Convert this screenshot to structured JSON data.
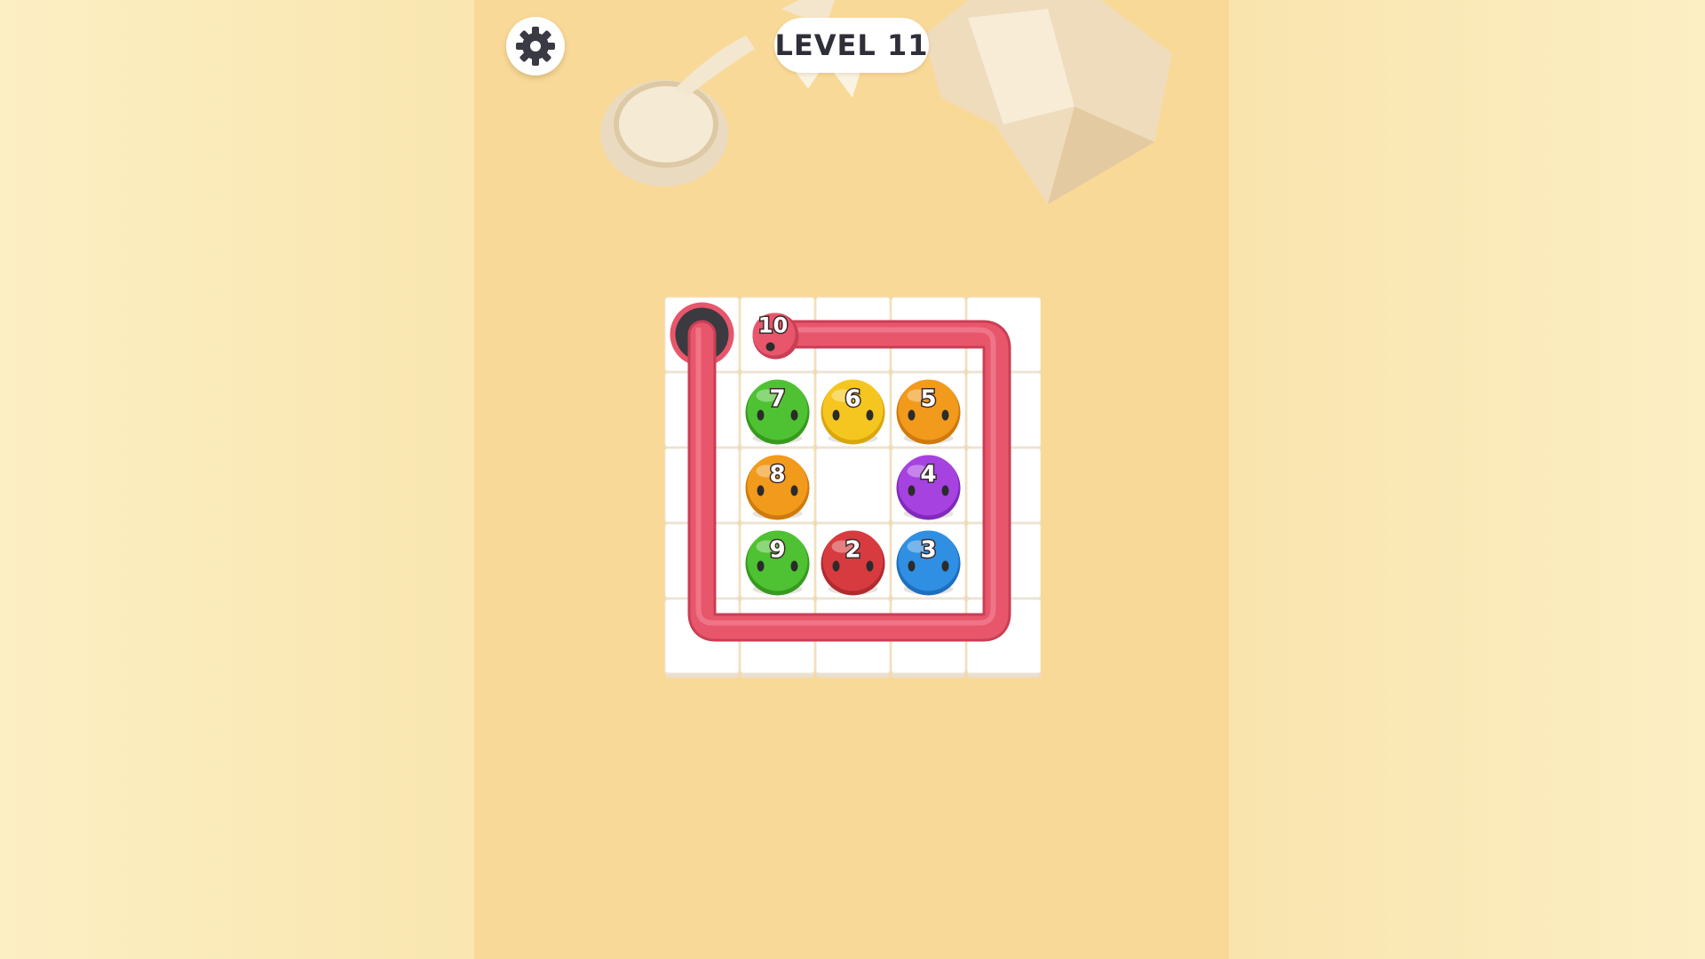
{
  "header": {
    "level_label": "LEVEL 11"
  },
  "icons": {
    "settings": "gear-icon"
  },
  "colors": {
    "background": "#f8d998",
    "board_tile": "#ffffff",
    "snake": "#e8566b",
    "hole": "#3a3a40",
    "green": "#4fc233",
    "yellow": "#f5c61f",
    "orange": "#f29a1c",
    "purple": "#a643e0",
    "red": "#d83b3f",
    "blue": "#2f8fe3"
  },
  "board": {
    "rows": 5,
    "cols": 5,
    "hole": {
      "row": 0,
      "col": 0
    },
    "snake": {
      "number": "10",
      "color": "red",
      "head": {
        "row": 0,
        "col": 1
      }
    },
    "balls": [
      {
        "number": "7",
        "color": "green",
        "row": 1,
        "col": 1
      },
      {
        "number": "6",
        "color": "yellow",
        "row": 1,
        "col": 2
      },
      {
        "number": "5",
        "color": "orange",
        "row": 1,
        "col": 3
      },
      {
        "number": "8",
        "color": "orange",
        "row": 2,
        "col": 1
      },
      {
        "number": "4",
        "color": "purple",
        "row": 2,
        "col": 3
      },
      {
        "number": "9",
        "color": "green",
        "row": 3,
        "col": 1
      },
      {
        "number": "2",
        "color": "red",
        "row": 3,
        "col": 2
      },
      {
        "number": "3",
        "color": "blue",
        "row": 3,
        "col": 3
      }
    ]
  }
}
